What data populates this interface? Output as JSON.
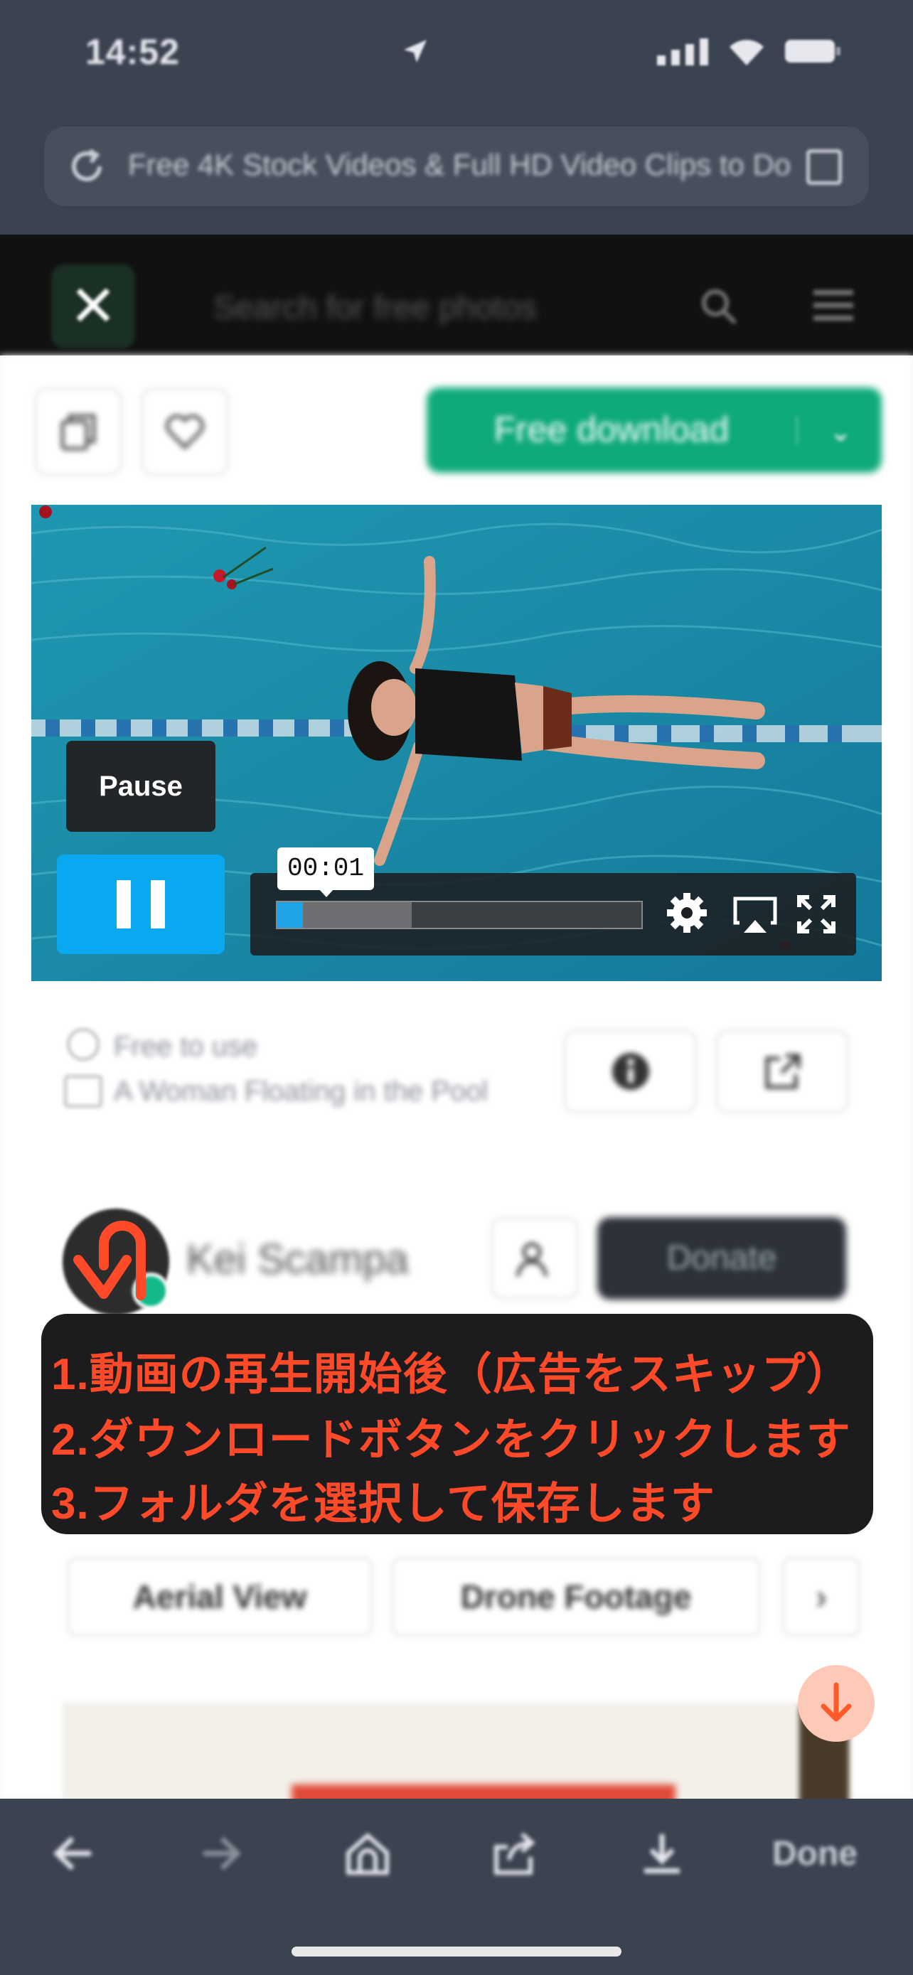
{
  "status_bar": {
    "time": "14:52"
  },
  "browser": {
    "url_text": "Free 4K Stock Videos & Full HD Video Clips to Do",
    "done_label": "Done"
  },
  "site_header": {
    "search_placeholder": "Search for free photos"
  },
  "actions": {
    "free_download_label": "Free download"
  },
  "video": {
    "pause_tooltip": "Pause",
    "current_time": "00:01",
    "progress_played": 0.07,
    "progress_buffered": 0.37
  },
  "details": {
    "license_text": "Free to use",
    "title_text": "A Woman Floating in the Pool"
  },
  "author": {
    "name": "Kei Scampa",
    "donate_label": "Donate"
  },
  "instructions": {
    "line1": "1.動画の再生開始後（広告をスキップ）",
    "line2": "2.ダウンロードボタンをクリックします",
    "line3": "3.フォルダを選択して保存します"
  },
  "tags": [
    "Aerial View",
    "Drone Footage"
  ],
  "colors": {
    "accent_green": "#0faa7a",
    "player_blue": "#0aa8f0",
    "instruction_red": "#ff4a2a",
    "browser_chrome": "#3b4250"
  }
}
